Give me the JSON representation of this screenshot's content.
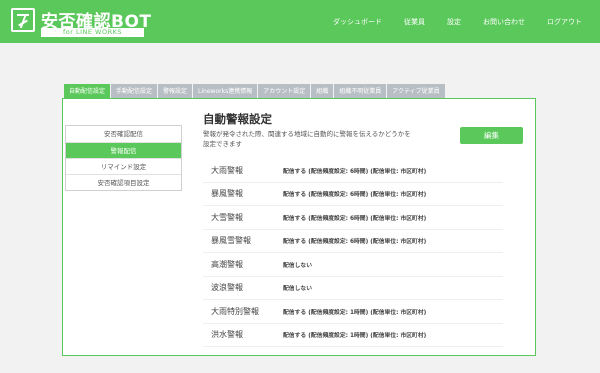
{
  "app": {
    "title": "安否確認BOT",
    "subtitle": "for LINE WORKS"
  },
  "nav": [
    "ダッシュボード",
    "従業員",
    "設定",
    "お問い合わせ",
    "ログアウト"
  ],
  "tabs": [
    "自動配信設定",
    "手動配信設定",
    "警報設定",
    "Lineworks連携情報",
    "アカウント設定",
    "組織",
    "組織不明従業員",
    "アクティブ従業員"
  ],
  "side_menu": [
    "安否確認配信",
    "警報配信",
    "リマインド設定",
    "安否確認項目設定"
  ],
  "content": {
    "title": "自動警報設定",
    "description": "警報が発令された際、関連する地域に自動的に警報を伝えるかどうかを設定できます",
    "edit_label": "編集"
  },
  "alerts": [
    {
      "name": "大雨警報",
      "value": "配信する (配信頻度設定: 6時間) (配信単位: 市区町村)"
    },
    {
      "name": "暴風警報",
      "value": "配信する (配信頻度設定: 6時間) (配信単位: 市区町村)"
    },
    {
      "name": "大雪警報",
      "value": "配信する (配信頻度設定: 6時間) (配信単位: 市区町村)"
    },
    {
      "name": "暴風雪警報",
      "value": "配信する (配信頻度設定: 6時間) (配信単位: 市区町村)"
    },
    {
      "name": "高潮警報",
      "value": "配信しない"
    },
    {
      "name": "波浪警報",
      "value": "配信しない"
    },
    {
      "name": "大雨特別警報",
      "value": "配信する (配信頻度設定: 1時間) (配信単位: 市区町村)"
    },
    {
      "name": "洪水警報",
      "value": "配信する (配信頻度設定: 1時間) (配信単位: 市区町村)"
    }
  ],
  "colors": {
    "accent": "#5ac85a",
    "tab_inactive": "#b8bfc4"
  }
}
